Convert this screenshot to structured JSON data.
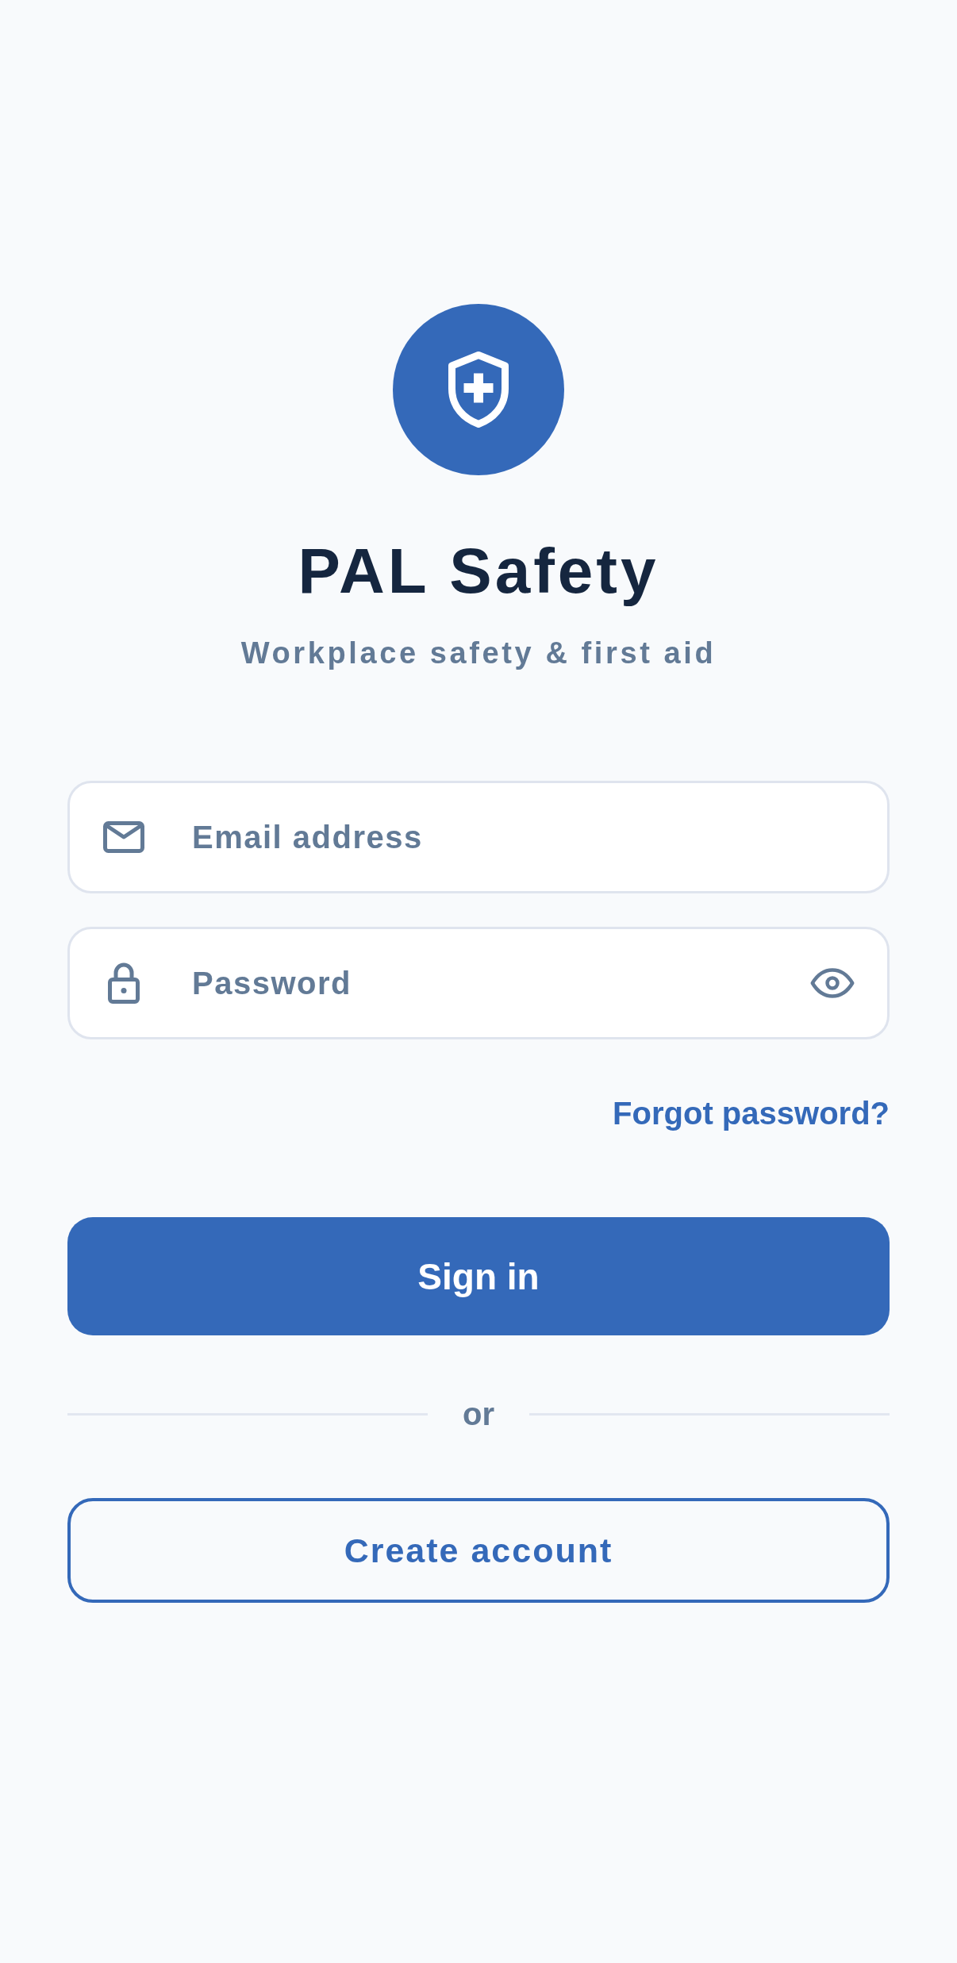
{
  "header": {
    "title": "PAL Safety",
    "subtitle": "Workplace safety & first aid"
  },
  "form": {
    "fields": [
      {
        "kind": "email",
        "placeholder": "Email address"
      },
      {
        "kind": "password",
        "placeholder": "Password"
      }
    ],
    "forgot_link": "Forgot password?",
    "primary_button": "Sign in",
    "divider": "or",
    "secondary_button": "Create account"
  }
}
